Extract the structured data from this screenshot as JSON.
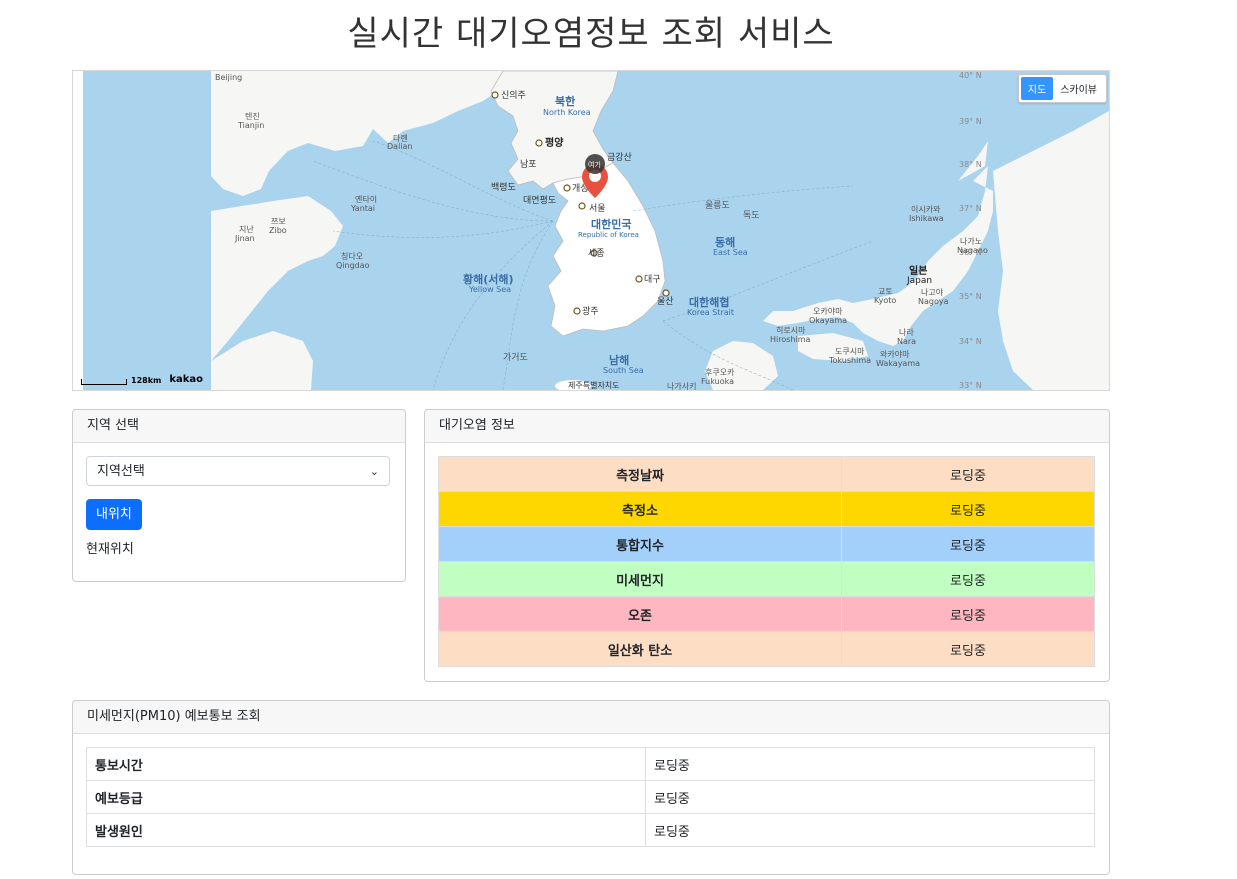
{
  "page": {
    "title": "실시간 대기오염정보 조회 서비스"
  },
  "map": {
    "type_buttons": [
      "지도",
      "스카이뷰"
    ],
    "active_type": "지도",
    "scale_label": "128km",
    "logo": "kakao",
    "marker_label": "여기",
    "labels": {
      "beijing": "Beijing",
      "tianjin": [
        "텐진",
        "Tianjin"
      ],
      "dalian": [
        "다롄",
        "Dalian"
      ],
      "yantai": [
        "옌타이",
        "Yantai"
      ],
      "zibo": [
        "쯔보",
        "Zibo"
      ],
      "jinan": [
        "지난",
        "Jinan"
      ],
      "qingdao": [
        "칭다오",
        "Qingdao"
      ],
      "sinuiju": "신의주",
      "north_korea": [
        "북한",
        "North Korea"
      ],
      "pyongyang": "평양",
      "nampo": "남포",
      "geumgangsan": "금강산",
      "baengnyeongdo": "백령도",
      "daeyeonpyeongdo": "대연평도",
      "gaeseong": "개성",
      "seoul": "서울",
      "south_korea": [
        "대한민국",
        "Republic of Korea"
      ],
      "sejong": "세종",
      "daegu": "대구",
      "ulsan": "울산",
      "gwangju": "광주",
      "yellow_sea": [
        "황해(서해)",
        "Yellow Sea"
      ],
      "ulleungdo": "울릉도",
      "dokdo": "독도",
      "east_sea": [
        "동해",
        "East Sea"
      ],
      "korea_strait": [
        "대한해협",
        "Korea Strait"
      ],
      "south_sea": [
        "남해",
        "South Sea"
      ],
      "gageodo": "가거도",
      "jeju": "제주특별자치도",
      "japan": [
        "일본",
        "Japan"
      ],
      "ishikawa": [
        "이시카와",
        "Ishikawa"
      ],
      "nagano": [
        "나가노",
        "Nagano"
      ],
      "kyoto": [
        "교토",
        "Kyoto"
      ],
      "nagoya": [
        "나고야",
        "Nagoya"
      ],
      "okayama": [
        "오카야마",
        "Okayama"
      ],
      "hiroshima": [
        "히로시마",
        "Hiroshima"
      ],
      "nara": [
        "나라",
        "Nara"
      ],
      "tokushima": [
        "도쿠시마",
        "Tokushima"
      ],
      "wakayama": [
        "와카야마",
        "Wakayama"
      ],
      "fukuoka": [
        "후쿠오카",
        "Fukuoka"
      ],
      "nagasaki": "나가사키"
    },
    "lat_ticks": [
      "40° N",
      "39° N",
      "38° N",
      "37° N",
      "36° N",
      "35° N",
      "34° N",
      "33° N"
    ]
  },
  "region": {
    "header": "지역 선택",
    "select_value": "지역선택",
    "locate_button": "내위치",
    "current_location": "현재위치"
  },
  "air": {
    "header": "대기오염 정보",
    "rows": [
      {
        "label": "측정날짜",
        "value": "로딩중",
        "color": "#fddec4"
      },
      {
        "label": "측정소",
        "value": "로딩중",
        "color": "#ffd700"
      },
      {
        "label": "통합지수",
        "value": "로딩중",
        "color": "#a2d0fb"
      },
      {
        "label": "미세먼지",
        "value": "로딩중",
        "color": "#c1fec1"
      },
      {
        "label": "오존",
        "value": "로딩중",
        "color": "#feb6c1"
      },
      {
        "label": "일산화 탄소",
        "value": "로딩중",
        "color": "#fddec4"
      }
    ]
  },
  "forecast": {
    "header": "미세먼지(PM10) 예보통보 조회",
    "rows": [
      {
        "label": "통보시간",
        "value": "로딩중"
      },
      {
        "label": "예보등급",
        "value": "로딩중"
      },
      {
        "label": "발생원인",
        "value": "로딩중"
      }
    ]
  }
}
